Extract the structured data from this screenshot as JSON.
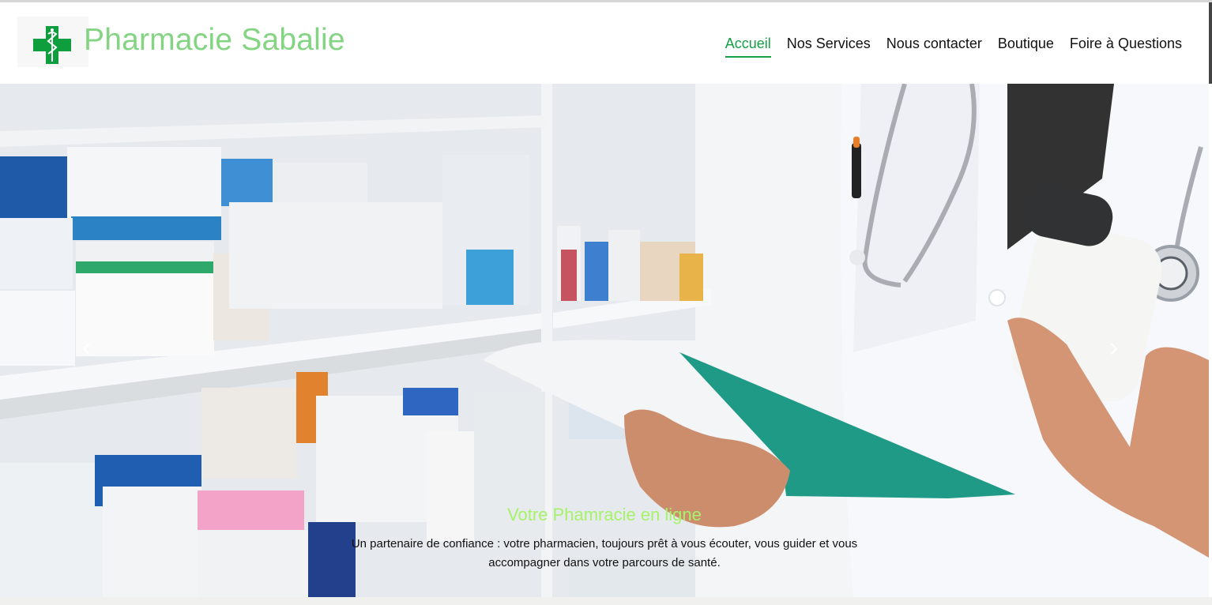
{
  "brand": {
    "name": "Pharmacie Sabalie",
    "logo_icon": "green-cross-caduceus-icon",
    "name_color": "#84d483"
  },
  "nav": {
    "items": [
      {
        "label": "Accueil",
        "active": true
      },
      {
        "label": "Nos Services",
        "active": false
      },
      {
        "label": "Nous contacter",
        "active": false
      },
      {
        "label": "Boutique",
        "active": false
      },
      {
        "label": "Foire à Questions",
        "active": false
      }
    ],
    "active_color": "#14a043"
  },
  "hero": {
    "image_icon": "pharmacist-holding-clipboard-and-bottle-image",
    "prev_icon": "chevron-left-icon",
    "next_icon": "chevron-right-icon",
    "prev_glyph": "‹",
    "next_glyph": "›",
    "caption_title": "Votre Phamracie en ligne",
    "caption_text": "Un partenaire de confiance : votre pharmacien, toujours prêt à vous écouter, vous guider et vous accompagner dans votre parcours de santé.",
    "caption_title_color": "#a6f26a"
  }
}
